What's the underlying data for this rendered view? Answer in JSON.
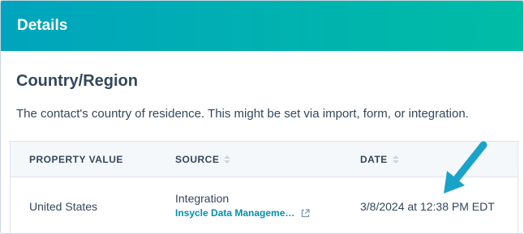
{
  "header": {
    "title": "Details"
  },
  "section": {
    "title": "Country/Region",
    "description": "The contact's country of residence. This might be set via import, form, or integration."
  },
  "table": {
    "columns": [
      {
        "label": "PROPERTY VALUE",
        "sortable": false
      },
      {
        "label": "SOURCE",
        "sortable": true
      },
      {
        "label": "DATE",
        "sortable": true
      }
    ],
    "rows": [
      {
        "value": "United States",
        "source": "Integration",
        "source_link": "Insycle Data Manageme…",
        "date": "3/8/2024 at 12:38 PM EDT"
      }
    ]
  },
  "colors": {
    "header_gradient_start": "#00a4bd",
    "header_gradient_end": "#00bda5",
    "link": "#0091ae",
    "annotation_arrow": "#1aa3c8",
    "text": "#33475b"
  },
  "icons": {
    "external_link": "external-link-icon",
    "annotation": "arrow-annotation-icon"
  }
}
